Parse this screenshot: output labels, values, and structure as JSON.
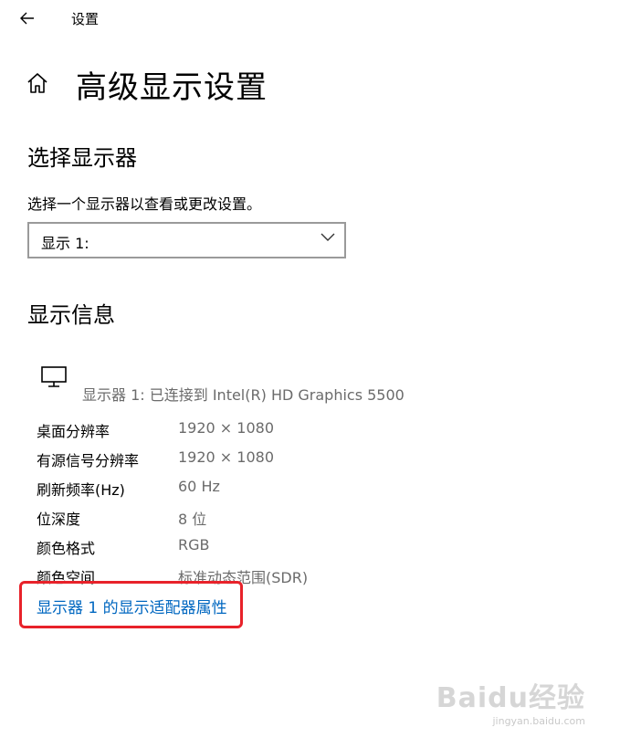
{
  "topbar": {
    "back_icon": "arrow-left-icon",
    "app_title": "设置"
  },
  "header": {
    "home_icon": "home-icon",
    "title": "高级显示设置"
  },
  "select_section": {
    "heading": "选择显示器",
    "description": "选择一个显示器以查看或更改设置。",
    "dropdown_value": "显示 1:",
    "dropdown_icon": "chevron-down-icon"
  },
  "info_section": {
    "heading": "显示信息",
    "monitor_icon": "monitor-icon",
    "monitor_desc": "显示器 1: 已连接到 Intel(R) HD Graphics 5500",
    "rows": [
      {
        "label": "桌面分辨率",
        "value": "1920 × 1080"
      },
      {
        "label": "有源信号分辨率",
        "value": "1920 × 1080"
      },
      {
        "label": "刷新频率(Hz)",
        "value": "60 Hz"
      },
      {
        "label": "位深度",
        "value": "8 位"
      },
      {
        "label": "颜色格式",
        "value": "RGB"
      },
      {
        "label": "颜色空间",
        "value": "标准动态范围(SDR)"
      }
    ],
    "adapter_link": "显示器 1 的显示适配器属性"
  },
  "colors": {
    "link": "#0067c0",
    "highlight": "#e8222a",
    "secondary_text": "#6b6b6b"
  },
  "watermark": {
    "logo": "Baidu经验",
    "url": "jingyan.baidu.com"
  }
}
